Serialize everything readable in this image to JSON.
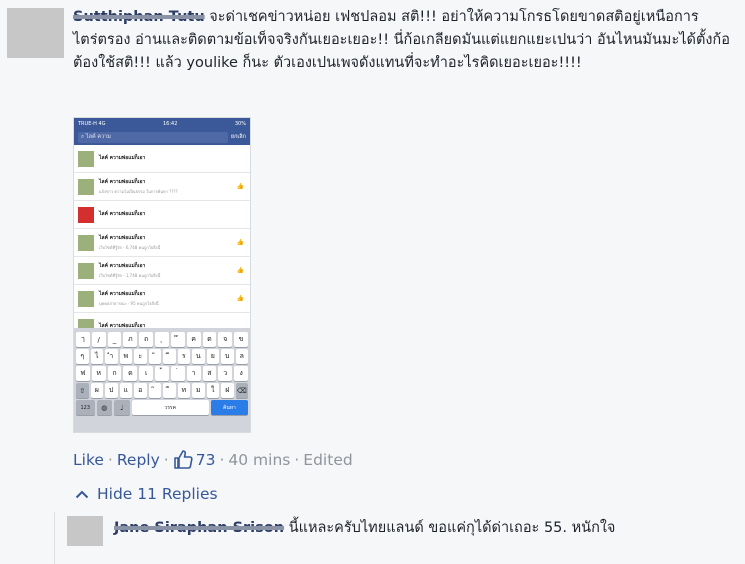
{
  "comment": {
    "author": "Sutthiphan Tutu",
    "text": "จะด่าเชคข่าวหน่อย เฟชปลอม สติ!!! อย่าให้ความโกรธโดยขาดสติอยู่เหนือการไตร่ตรอง อ่านและติดตามข้อเท็จจริงกันเยอะเยอะ!! นี่ก้อเกลียดมันแต่แยกแยะเปนว่า อันไหนมันมะได้ตั้งก้อต้องใช้สติ!!! แล้ว youlike ก็นะ ตัวเองเปนเพจดังแทนที่จะทำอะไรคิดเยอะเยอะ!!!!",
    "like": "Like",
    "reply": "Reply",
    "reactions": "73",
    "time": "40 mins",
    "edited": "Edited",
    "hide_replies": "Hide 11 Replies"
  },
  "reply": {
    "author": "Jane Siraphan Srison",
    "text": "นี้แหละครับไทยแลนด์ ขอแค่กุได้ด่าเถอะ 55. หนักใจ"
  },
  "phone": {
    "carrier": "TRUE-H 4G",
    "clock": "16:42",
    "battery": "30%",
    "search_text": "ไลค์ ความ",
    "cancel": "ยกเลิก",
    "results": [
      {
        "title": "ไลค์ ความพ่อแม่ก็เอา",
        "sub": "",
        "red": false
      },
      {
        "title": "ไลค์ ความพ่อแม่ก็เอา",
        "sub": "แจ้งข่าว ความไม่เป็นธรรม ในการค้นหา ????",
        "red": false
      },
      {
        "title": "ไลค์ ความพ่อแม่ก็เอา",
        "sub": "",
        "red": true
      },
      {
        "title": "ไลค์ ความพ่อแม่ก็เอา",
        "sub": "เว็บไซต์ที่รู้จัก · 6,748 คนถูกใจสิ่งนี้",
        "red": false
      },
      {
        "title": "ไลค์ ความพ่อแม่ก็เอา",
        "sub": "เว็บไซต์ที่รู้จัก · 1,748 คนถูกใจสิ่งนี้",
        "red": false
      },
      {
        "title": "ไลค์ ความพ่อแม่ก็เอา",
        "sub": "บุคคลสาธารณะ · 95 คนถูกใจสิ่งนี้",
        "red": false
      },
      {
        "title": "ไลค์ ความพ่อแม่ก็เอา",
        "sub": "",
        "red": false
      }
    ],
    "keyboard": {
      "row1": [
        "ๅ",
        "/",
        "_",
        "ภ",
        "ถ",
        "ุ",
        "ึ",
        "ค",
        "ต",
        "จ",
        "ข"
      ],
      "row2": [
        "ๆ",
        "ไ",
        "ำ",
        "พ",
        "ะ",
        "ั",
        "ี",
        "ร",
        "น",
        "ย",
        "บ",
        "ล"
      ],
      "row3": [
        "ฟ",
        "ห",
        "ก",
        "ด",
        "เ",
        "้",
        "่",
        "า",
        "ส",
        "ว",
        "ง"
      ],
      "row4": [
        "ผ",
        "ป",
        "แ",
        "อ",
        "ิ",
        "ื",
        "ท",
        "ม",
        "ใ",
        "ฝ"
      ],
      "num_key": "123",
      "space": "วรรค",
      "search_key": "ค้นหา"
    }
  },
  "colors": {
    "link": "#365899",
    "meta": "#90949c",
    "fb_blue": "#3b5998"
  }
}
